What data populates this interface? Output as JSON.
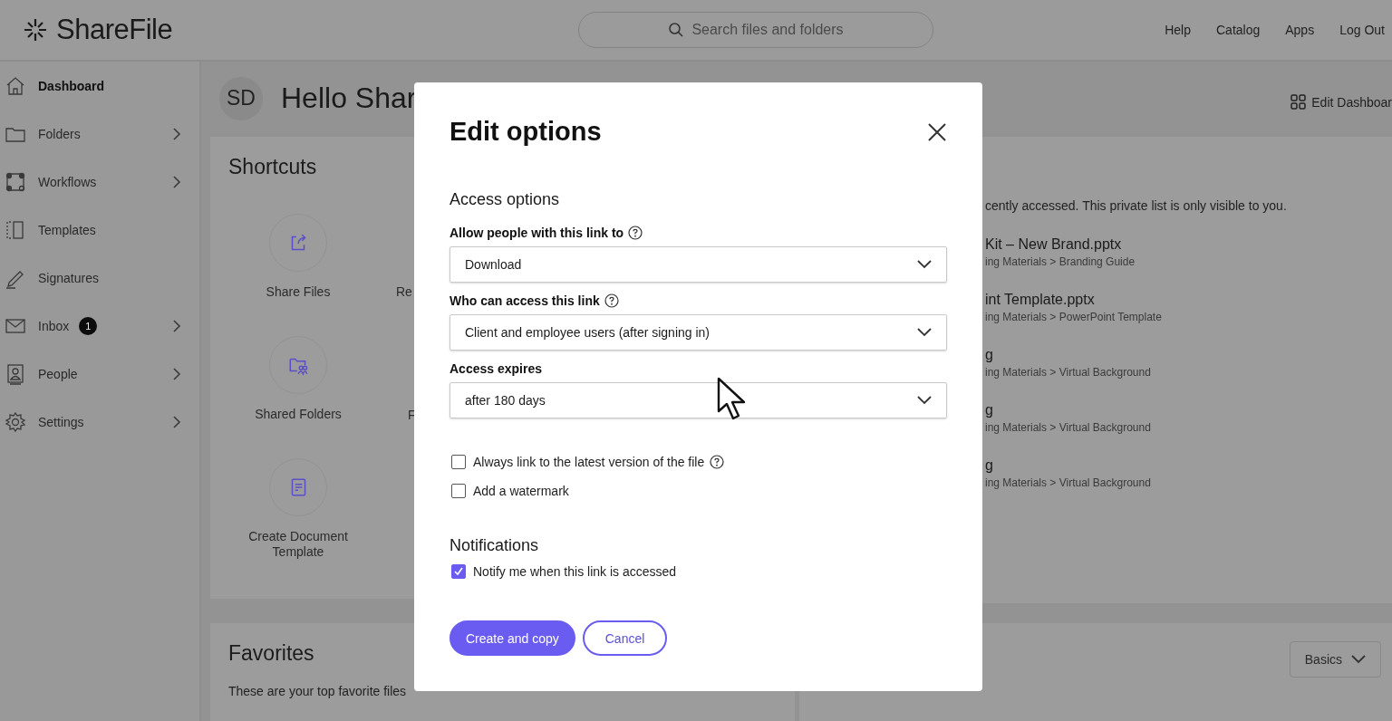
{
  "header": {
    "logo": "ShareFile",
    "search_placeholder": "Search files and folders",
    "links": [
      "Help",
      "Catalog",
      "Apps",
      "Log Out"
    ]
  },
  "sidebar": {
    "items": [
      {
        "label": "Dashboard",
        "chevron": false,
        "selected": true
      },
      {
        "label": "Folders",
        "chevron": true,
        "selected": false
      },
      {
        "label": "Workflows",
        "chevron": true,
        "selected": false
      },
      {
        "label": "Templates",
        "chevron": false,
        "selected": false
      },
      {
        "label": "Signatures",
        "chevron": false,
        "selected": false
      },
      {
        "label": "Inbox",
        "chevron": true,
        "badge": "1",
        "selected": false
      },
      {
        "label": "People",
        "chevron": true,
        "selected": false
      },
      {
        "label": "Settings",
        "chevron": true,
        "selected": false
      }
    ]
  },
  "greeting": {
    "avatar": "SD",
    "text": "Hello Shar",
    "edit": "Edit Dashboar"
  },
  "shortcuts": {
    "title": "Shortcuts",
    "items": [
      {
        "label": "Share Files",
        "kind": "tile"
      },
      {
        "label": "Re",
        "kind": "label"
      },
      {
        "label": "Shared Folders",
        "kind": "tile"
      },
      {
        "label": "F",
        "kind": "label"
      },
      {
        "label": "Create Document Template",
        "kind": "tile"
      }
    ]
  },
  "recent": {
    "description": "cently accessed. This private list is only visible to you.",
    "files": [
      {
        "name": "Kit – New Brand.pptx",
        "path": "ing Materials > Branding Guide"
      },
      {
        "name": "int Template.pptx",
        "path": "ing Materials > PowerPoint Template"
      },
      {
        "name": "g",
        "path": "ing Materials > Virtual Background"
      },
      {
        "name": "g",
        "path": "ing Materials > Virtual Background"
      },
      {
        "name": "g",
        "path": "ing Materials > Virtual Background"
      }
    ]
  },
  "favorites": {
    "title": "Favorites",
    "description": "These are your top favorite files"
  },
  "learn": {
    "dropdown": "Basics"
  },
  "modal": {
    "title": "Edit options",
    "section": "Access options",
    "fields": [
      {
        "label": "Allow people with this link to",
        "help": true,
        "value": "Download"
      },
      {
        "label": "Who can access this link",
        "help": true,
        "value": "Client and employee users (after signing in)"
      },
      {
        "label": "Access expires",
        "help": false,
        "value": "after 180 days"
      }
    ],
    "options": [
      {
        "label": "Always link to the latest version of the file",
        "checked": false,
        "help": true
      },
      {
        "label": "Add a watermark",
        "checked": false,
        "help": false
      }
    ],
    "notifications_title": "Notifications",
    "notifications": [
      {
        "label": "Notify me when this link is accessed",
        "checked": true
      }
    ],
    "buttons": [
      {
        "label": "Create and copy",
        "kind": "primary"
      },
      {
        "label": "Cancel",
        "kind": "secondary"
      }
    ]
  }
}
